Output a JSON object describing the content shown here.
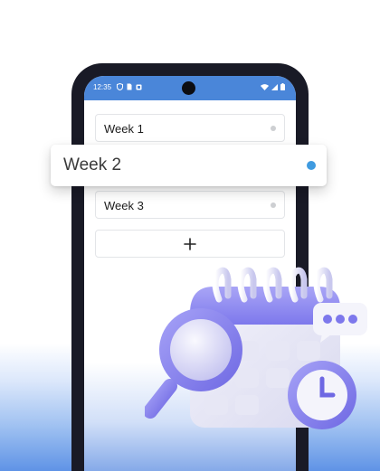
{
  "status_bar": {
    "time": "12:35",
    "icons": [
      "shield-icon",
      "sim-icon",
      "notification-icon",
      "wifi-icon",
      "signal-icon",
      "battery-icon"
    ]
  },
  "weeks": [
    {
      "label": "Week 1",
      "active": false
    },
    {
      "label": "Week 2",
      "active": true
    },
    {
      "label": "Week 3",
      "active": false
    }
  ],
  "add_button": {
    "icon": "plus-icon"
  },
  "colors": {
    "status_bar": "#4a86d9",
    "active_dot": "#3f9be0",
    "inactive_dot": "#cdcfd2",
    "phone_frame": "#191a26",
    "illustration_accent": "#8b86f0"
  },
  "illustration": {
    "icons": [
      "calendar-icon",
      "magnifier-icon",
      "clock-icon",
      "chat-bubble-icon"
    ]
  }
}
